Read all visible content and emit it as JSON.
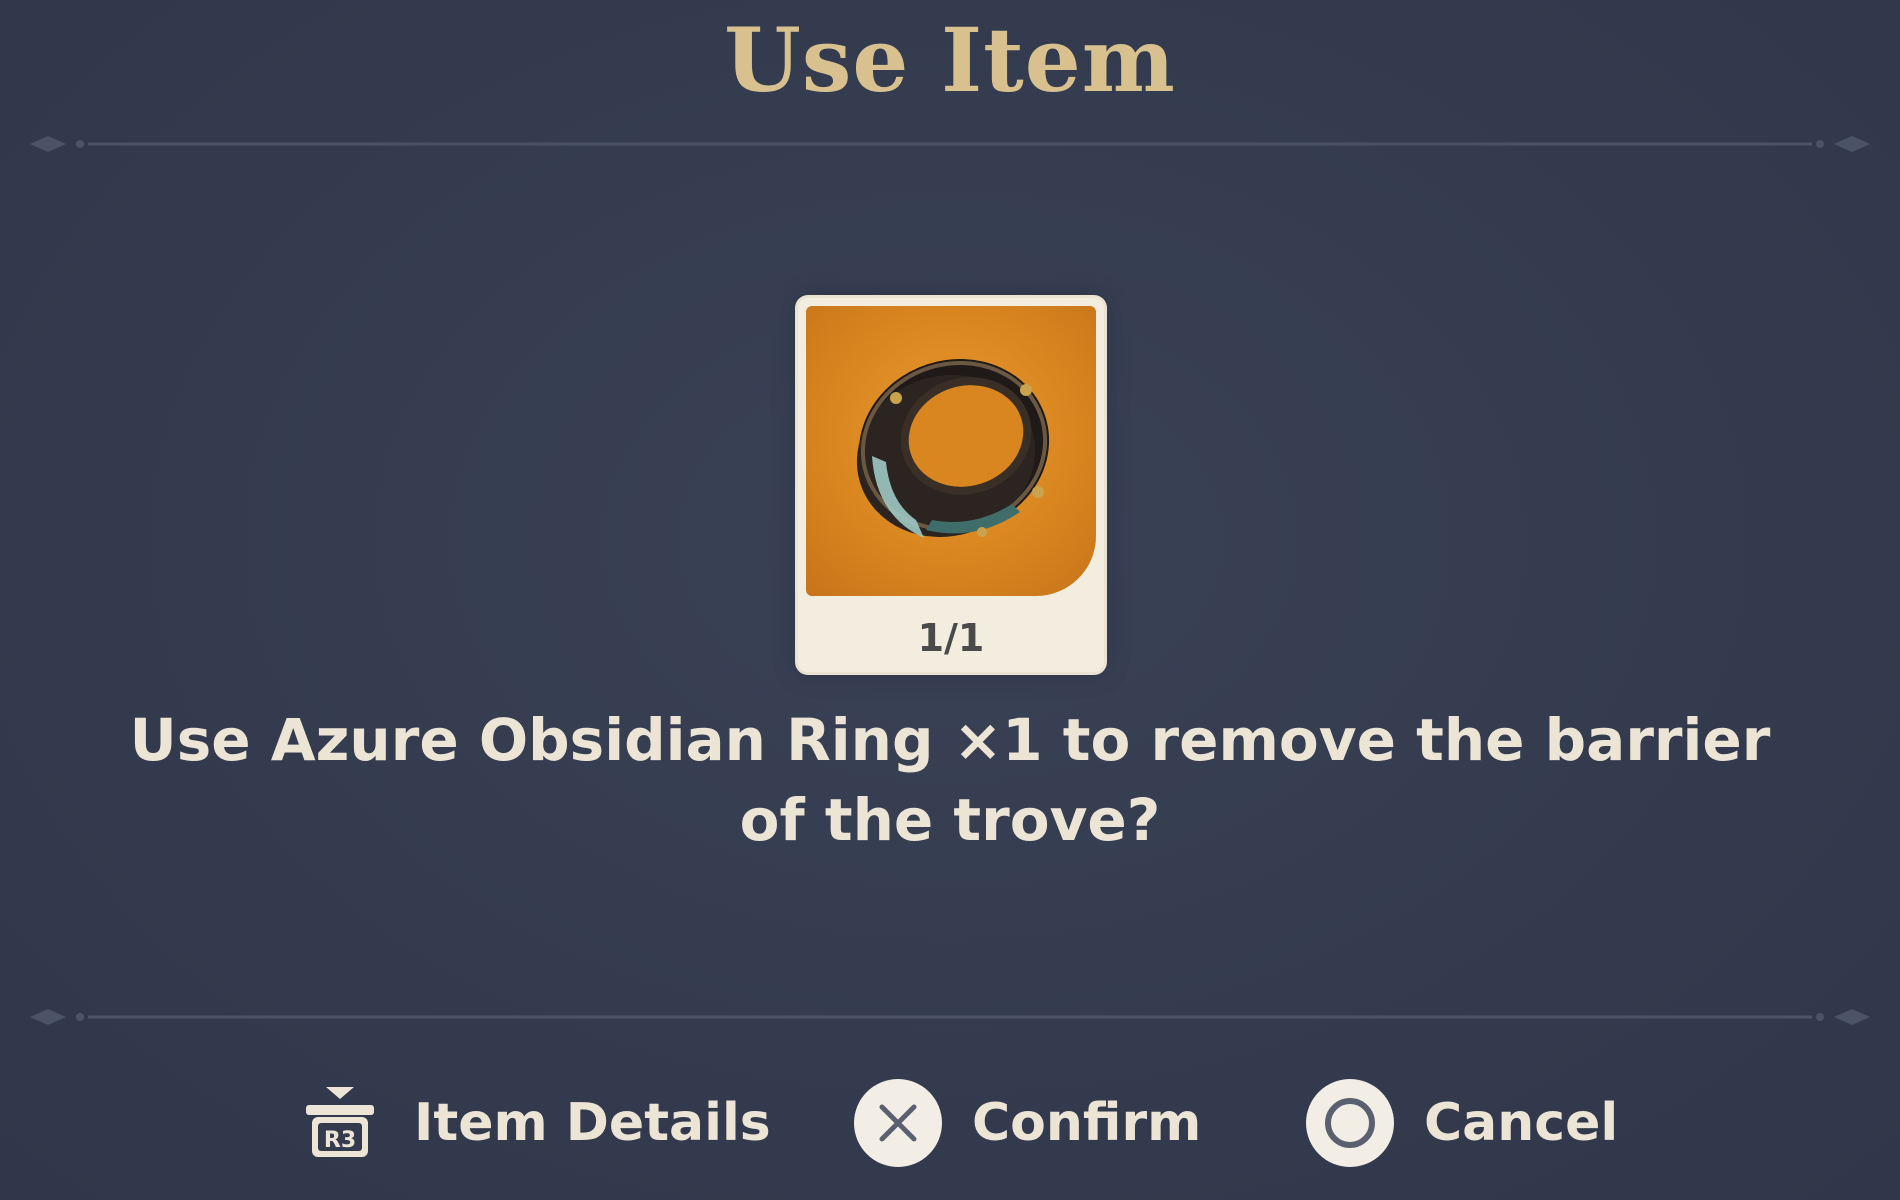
{
  "dialog": {
    "title": "Use Item",
    "message_line1": "Use Azure Obsidian Ring ×1 to remove the barrier",
    "message_line2": "of the trove?"
  },
  "item": {
    "name": "Azure Obsidian Ring",
    "icon": "ring-icon",
    "count_label": "1/1",
    "background_color": "#d98620"
  },
  "actions": {
    "details": {
      "label": "Item Details",
      "button": "R3",
      "icon": "r3-button-icon"
    },
    "confirm": {
      "label": "Confirm",
      "icon": "cross-button-icon"
    },
    "cancel": {
      "label": "Cancel",
      "icon": "circle-button-icon"
    }
  },
  "colors": {
    "background": "#343b4e",
    "title": "#d8c18f",
    "text": "#ece5d5"
  }
}
